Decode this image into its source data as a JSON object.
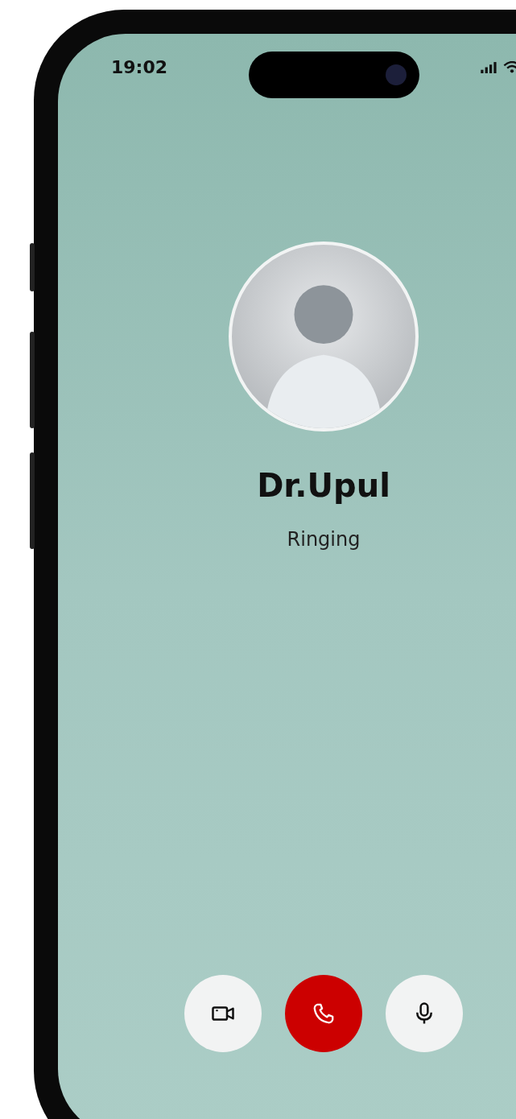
{
  "status_bar": {
    "time": "19:02"
  },
  "caller": {
    "name": "Dr.Upul",
    "status": "Ringing"
  },
  "call_controls": [
    {
      "kind": "video"
    },
    {
      "kind": "end_call"
    },
    {
      "kind": "microphone"
    }
  ]
}
